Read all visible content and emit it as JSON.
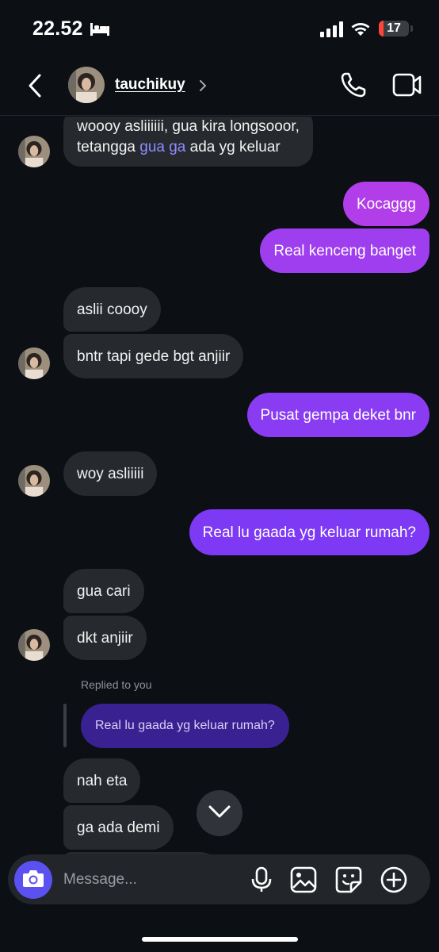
{
  "status_bar": {
    "time": "22.52",
    "battery_level": "17",
    "icons": [
      "bed-icon",
      "signal-icon",
      "wifi-icon",
      "battery-icon"
    ],
    "battery_color": "#ff4438"
  },
  "header": {
    "username": "tauchikuy",
    "icons": [
      "back-icon",
      "chevron-right-icon",
      "phone-icon",
      "video-icon"
    ]
  },
  "colors": {
    "sent_gradient_top": "#b13ee9",
    "sent_gradient_bottom": "#8a3cf2",
    "received": "#26292e",
    "reply_bubble": "#3a2192",
    "camera_button": "#5b51f0",
    "highlight": "#8f8cff"
  },
  "messages": [
    {
      "from": "them",
      "line1": "woooy asliiiiii, gua kira longsooor,",
      "line2_before": "tetangga ",
      "line2_highlight": "gua ga",
      "line2_after": " ada yg keluar"
    },
    {
      "from": "me",
      "text": "Kocaggg"
    },
    {
      "from": "me",
      "text": "Real kenceng banget"
    },
    {
      "from": "them",
      "text": "aslii coooy"
    },
    {
      "from": "them",
      "text": "bntr tapi gede bgt anjiir"
    },
    {
      "from": "me",
      "text": "Pusat gempa deket bnr"
    },
    {
      "from": "them",
      "text": "woy asliiiii"
    },
    {
      "from": "me",
      "text": "Real lu gaada yg keluar rumah?"
    },
    {
      "from": "them",
      "text": "gua cari"
    },
    {
      "from": "them",
      "text": "dkt anjiir"
    },
    {
      "from": "them",
      "text": "nah eta"
    },
    {
      "from": "them",
      "text": "ga ada demi"
    }
  ],
  "reply": {
    "label": "Replied to you",
    "quoted_text": "Real lu gaada yg keluar rumah?"
  },
  "composer": {
    "placeholder": "Message...",
    "icons": [
      "camera-icon",
      "mic-icon",
      "gallery-icon",
      "sticker-icon",
      "plus-icon"
    ]
  }
}
